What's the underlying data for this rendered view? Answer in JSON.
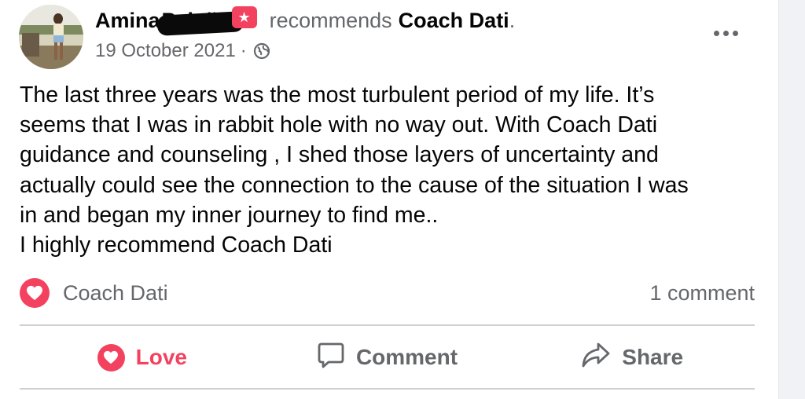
{
  "post": {
    "author": {
      "first_name": "Amina",
      "surname": "Paixão"
    },
    "recommends_text": "recommends",
    "page_name": "Coach Dati",
    "period": ".",
    "date": "19 October 2021",
    "meta_separator": "·",
    "audience_icon": "globe-icon",
    "body_lines": [
      "The last three years was the most turbulent period of my life. It’s",
      "seems that I was in rabbit hole with no way out. With Coach Dati",
      "guidance and counseling , I shed those layers of uncertainty and",
      "actually could see the connection to the cause of the situation I was",
      "in and began my inner journey to find me..",
      "I highly recommend Coach Dati"
    ]
  },
  "reactions": {
    "icon": "heart-icon",
    "name": "Coach Dati",
    "comment_count": "1 comment"
  },
  "actions": {
    "love_label": "Love",
    "comment_label": "Comment",
    "share_label": "Share"
  },
  "colors": {
    "accent_love": "#f3425f",
    "secondary_text": "#65676b",
    "primary_text": "#050505",
    "divider": "#ced0d4"
  }
}
